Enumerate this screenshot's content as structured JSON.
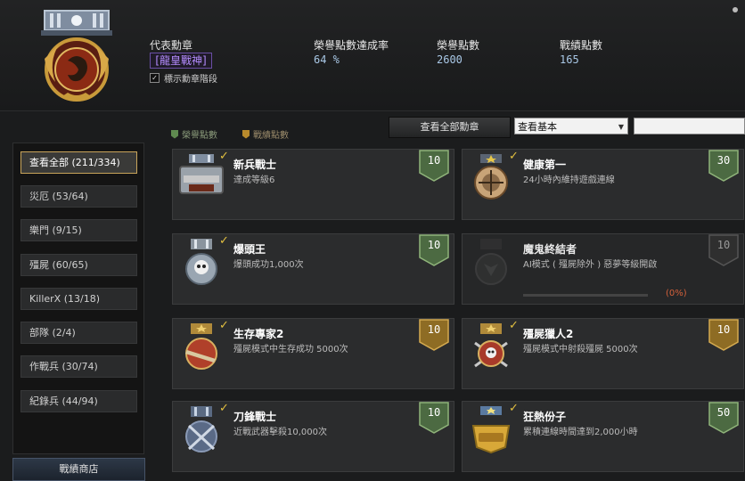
{
  "header": {
    "rep_medal_label": "代表勳章",
    "rep_medal_name": "[龍皇戰神]",
    "show_level_label": "標示勳章階段",
    "stats": [
      {
        "label": "榮譽點數達成率",
        "value": "64 %"
      },
      {
        "label": "榮譽點數",
        "value": "2600"
      },
      {
        "label": "戰績點數",
        "value": "165"
      }
    ]
  },
  "toolbar": {
    "legend_honor": "榮譽點數",
    "legend_record": "戰績點數",
    "view_all_button": "查看全部勳章",
    "filter_selected": "查看基本"
  },
  "sidebar": {
    "items": [
      {
        "label": "查看全部 (211/334)"
      },
      {
        "label": "災厄 (53/64)"
      },
      {
        "label": "樂門 (9/15)"
      },
      {
        "label": "殭屍 (60/65)"
      },
      {
        "label": "KillerX (13/18)"
      },
      {
        "label": "部隊 (2/4)"
      },
      {
        "label": "作戰兵 (30/74)"
      },
      {
        "label": "紀錄兵 (44/94)"
      }
    ],
    "shop_button": "戰績商店"
  },
  "medals": [
    {
      "name": "新兵戰士",
      "desc": "達成等級6",
      "points": "10",
      "type": "honor",
      "icon": "welcome-cso-medal-icon",
      "done": true
    },
    {
      "name": "健康第一",
      "desc": "24小時內維持遊戲連線",
      "points": "30",
      "type": "honor",
      "icon": "star-compass-medal-icon",
      "done": true
    },
    {
      "name": "爆頭王",
      "desc": "爆頭成功1,000次",
      "points": "10",
      "type": "honor",
      "icon": "skull-medal-icon",
      "done": true
    },
    {
      "name": "魔鬼終結者",
      "desc": "AI模式 ( 殭屍除外 ) 惡夢等級開啟",
      "points": "10",
      "type": "locked",
      "icon": "demon-medal-icon",
      "done": false,
      "progress_text": "(0%)",
      "progress": 0
    },
    {
      "name": "生存專家2",
      "desc": "殭屍模式中生存成功 5000次",
      "points": "10",
      "type": "record",
      "icon": "rifle-medal-icon",
      "done": true
    },
    {
      "name": "殭屍獵人2",
      "desc": "殭屍模式中射殺殭屍 5000次",
      "points": "10",
      "type": "record",
      "icon": "skull-swords-medal-icon",
      "done": true
    },
    {
      "name": "刀鋒戰士",
      "desc": "近戰武器擊殺10,000次",
      "points": "10",
      "type": "honor",
      "icon": "crossed-blades-medal-icon",
      "done": true
    },
    {
      "name": "狂熱份子",
      "desc": "累積連線時間達到2,000小時",
      "points": "50",
      "type": "honor",
      "icon": "gold-cso-medal-icon",
      "done": true
    }
  ],
  "colors": {
    "honor": "#4c6a42",
    "record": "#8e6c24",
    "locked": "#2f2f2f",
    "accent_purple": "#b58cff",
    "progress_text": "#d4603a"
  }
}
